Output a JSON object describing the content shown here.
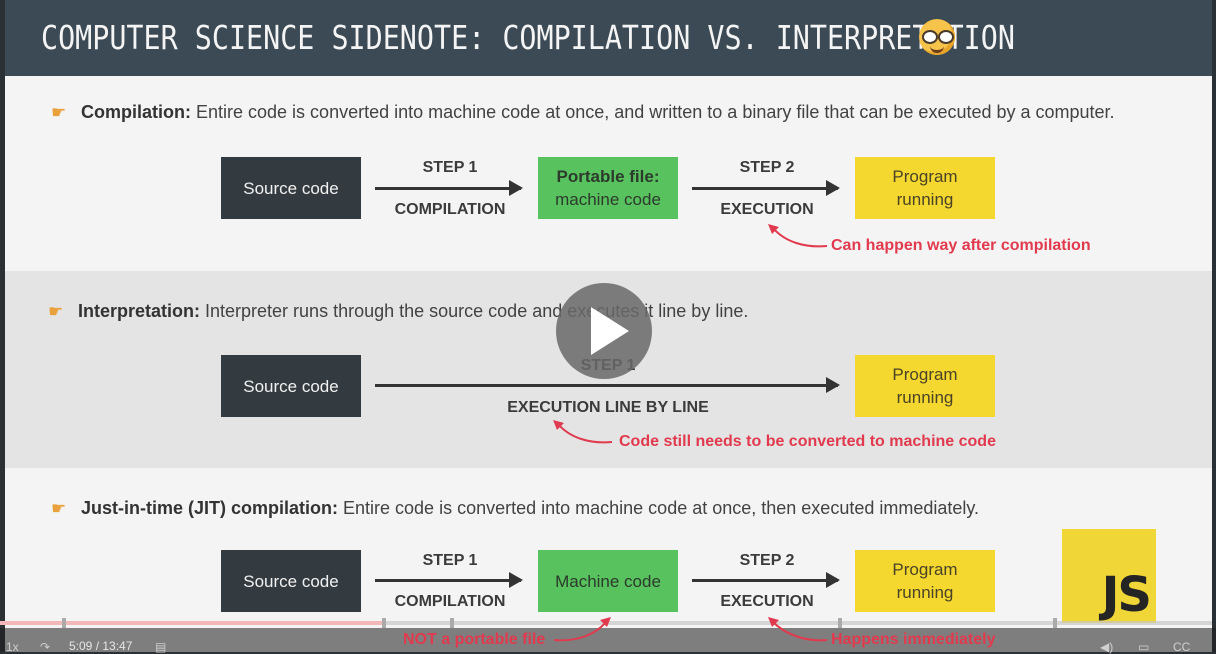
{
  "slide": {
    "title": "COMPUTER SCIENCE SIDENOTE: COMPILATION VS. INTERPRETATION",
    "title_icon": "nerd-face-icon"
  },
  "sections": {
    "compilation": {
      "term": "Compilation:",
      "desc": " Entire code is converted into machine code at once, and written to a binary file that can be executed by a computer.",
      "source": "Source code",
      "step1": "STEP 1",
      "step1_label": "COMPILATION",
      "portable_title": "Portable file:",
      "portable_sub": "machine code",
      "step2": "STEP 2",
      "step2_label": "EXECUTION",
      "program_l1": "Program",
      "program_l2": "running",
      "note": "Can happen way after compilation"
    },
    "interpretation": {
      "term": "Interpretation:",
      "desc": " Interpreter runs through the source code and executes it line by line.",
      "source": "Source code",
      "step1": "STEP 1",
      "step1_label": "EXECUTION LINE BY LINE",
      "program_l1": "Program",
      "program_l2": "running",
      "note": "Code still needs to be converted to machine code"
    },
    "jit": {
      "term": "Just-in-time (JIT) compilation:",
      "desc": " Entire code is converted into machine code at once, then executed immediately.",
      "source": "Source code",
      "step1": "STEP 1",
      "step1_label": "COMPILATION",
      "machine": "Machine code",
      "step2": "STEP 2",
      "step2_label": "EXECUTION",
      "program_l1": "Program",
      "program_l2": "running",
      "note_left": "NOT a portable file",
      "note_right": "Happens immediately"
    }
  },
  "badge": {
    "text": "JS"
  },
  "player": {
    "time": "5:09 / 13:47",
    "progress_fraction": 0.374,
    "colors": {
      "progress": "#f2b7b8",
      "accent_note": "#e13a4e"
    }
  },
  "colors": {
    "dark_box": "#343b40",
    "green_box": "#58c25e",
    "yellow_box": "#f4d72f",
    "header": "#3b4a54"
  }
}
